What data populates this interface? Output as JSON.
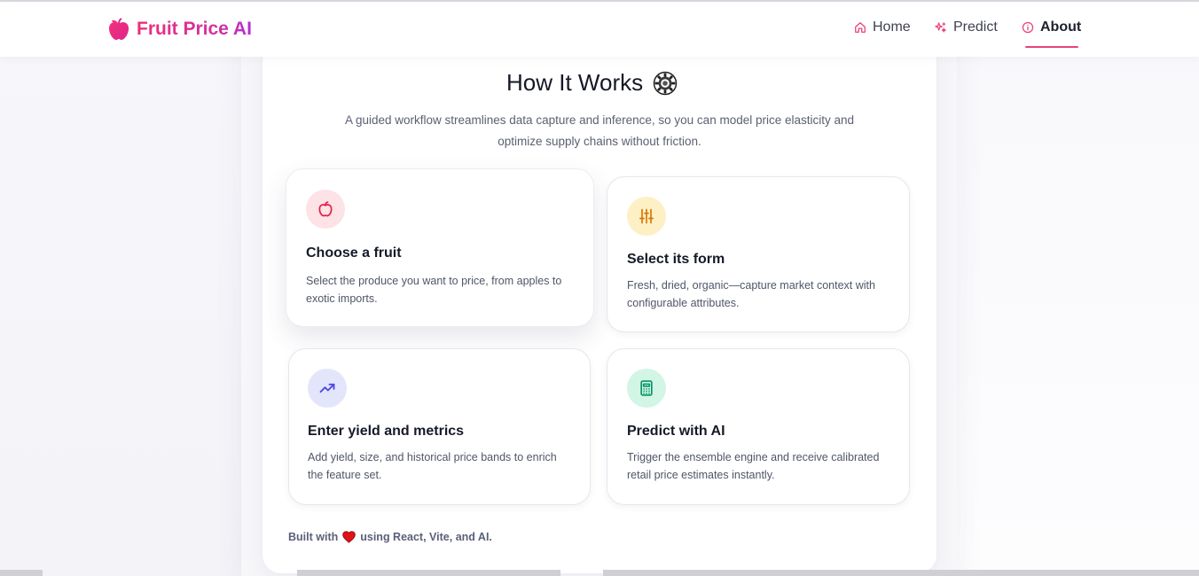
{
  "brand": {
    "name": "Fruit Price AI",
    "color": "#ec2f7a"
  },
  "nav": {
    "home": "Home",
    "predict": "Predict",
    "about": "About",
    "active": "About",
    "accent": "#e8427c"
  },
  "section": {
    "title": "How It Works",
    "title_icon": "gear-icon",
    "subtitle": "A guided workflow streamlines data capture and inference, so you can model price elasticity and optimize supply chains without friction."
  },
  "steps": [
    {
      "title": "Choose a fruit",
      "description": "Select the produce you want to price, from apples to exotic imports.",
      "icon": "apple-icon",
      "color": "#e11d48"
    },
    {
      "title": "Select its form",
      "description": "Fresh, dried, organic—capture market context with configurable attributes.",
      "icon": "sliders-icon",
      "color": "#d97706"
    },
    {
      "title": "Enter yield and metrics",
      "description": "Add yield, size, and historical price bands to enrich the feature set.",
      "icon": "trending-up-icon",
      "color": "#4f46e5"
    },
    {
      "title": "Predict with AI",
      "description": "Trigger the ensemble engine and receive calibrated retail price estimates instantly.",
      "icon": "calculator-icon",
      "color": "#059669"
    }
  ],
  "footer": {
    "prefix": "Built with",
    "suffix": "using React, Vite, and AI.",
    "heart_icon": "heart-icon"
  }
}
